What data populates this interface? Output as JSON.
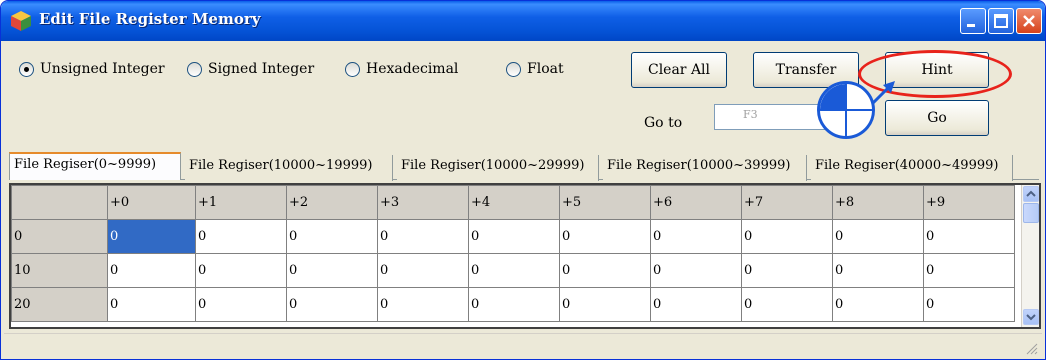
{
  "window": {
    "title": "Edit File Register Memory",
    "icon": "cube-icon"
  },
  "format_options": [
    {
      "label": "Unsigned Integer",
      "checked": true
    },
    {
      "label": "Signed Integer",
      "checked": false
    },
    {
      "label": "Hexadecimal",
      "checked": false
    },
    {
      "label": "Float",
      "checked": false
    }
  ],
  "buttons": {
    "clear_all": "Clear All",
    "transfer": "Transfer",
    "hint": "Hint",
    "go": "Go"
  },
  "goto": {
    "label": "Go to",
    "value": "F3"
  },
  "tabs": [
    "File Regiser(0~9999)",
    "File Regiser(10000~19999)",
    "File Regiser(10000~29999)",
    "File Regiser(10000~39999)",
    "File Regiser(40000~49999)"
  ],
  "grid": {
    "columns": [
      "+0",
      "+1",
      "+2",
      "+3",
      "+4",
      "+5",
      "+6",
      "+7",
      "+8",
      "+9"
    ],
    "rows": [
      {
        "label": "0",
        "values": [
          "0",
          "0",
          "0",
          "0",
          "0",
          "0",
          "0",
          "0",
          "0",
          "0"
        ]
      },
      {
        "label": "10",
        "values": [
          "0",
          "0",
          "0",
          "0",
          "0",
          "0",
          "0",
          "0",
          "0",
          "0"
        ]
      },
      {
        "label": "20",
        "values": [
          "0",
          "0",
          "0",
          "0",
          "0",
          "0",
          "0",
          "0",
          "0",
          "0"
        ]
      }
    ]
  },
  "annotation_colors": {
    "highlight": "#e8231b",
    "pointer": "#1a5ad7"
  }
}
